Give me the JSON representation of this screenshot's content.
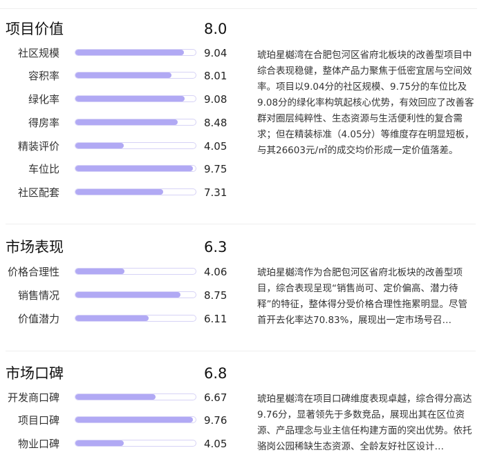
{
  "sections": [
    {
      "title": "项目价值",
      "score": "8.0",
      "metrics": [
        {
          "label": "社区规模",
          "value": "9.04",
          "fraction": 0.904
        },
        {
          "label": "容积率",
          "value": "8.01",
          "fraction": 0.801
        },
        {
          "label": "绿化率",
          "value": "9.08",
          "fraction": 0.908
        },
        {
          "label": "得房率",
          "value": "8.48",
          "fraction": 0.848
        },
        {
          "label": "精装评价",
          "value": "4.05",
          "fraction": 0.405
        },
        {
          "label": "车位比",
          "value": "9.75",
          "fraction": 0.975
        },
        {
          "label": "社区配套",
          "value": "7.31",
          "fraction": 0.731
        }
      ],
      "description": "琥珀星樾湾在合肥包河区省府北板块的改善型项目中综合表现稳健，整体产品力聚焦于低密宜居与空间效率。项目以9.04分的社区规模、9.75分的车位比及9.08分的绿化率构筑起核心优势，有效回应了改善客群对圈层纯粹性、生态资源与生活便利性的复合需求；但在精装标准（4.05分）等维度存在明显短板，与其26603元/㎡的成交均价形成一定价值落差。"
    },
    {
      "title": "市场表现",
      "score": "6.3",
      "metrics": [
        {
          "label": "价格合理性",
          "value": "4.06",
          "fraction": 0.406
        },
        {
          "label": "销售情况",
          "value": "8.75",
          "fraction": 0.875
        },
        {
          "label": "价值潜力",
          "value": "6.11",
          "fraction": 0.611
        }
      ],
      "description": "琥珀星樾湾作为合肥包河区省府北板块的改善型项目，综合表现呈现“销售尚可、定价偏高、潜力待释”的特征，整体得分受价格合理性拖累明显。尽管首开去化率达70.83%，展现出一定市场号召…"
    },
    {
      "title": "市场口碑",
      "score": "6.8",
      "metrics": [
        {
          "label": "开发商口碑",
          "value": "6.67",
          "fraction": 0.667
        },
        {
          "label": "项目口碑",
          "value": "9.76",
          "fraction": 0.976
        },
        {
          "label": "物业口碑",
          "value": "4.05",
          "fraction": 0.405
        }
      ],
      "description": "琥珀星樾湾在项目口碑维度表现卓越，综合得分高达9.76分，显著领先于多数竞品，展现出其在区位资源、产品理念与业主信任构建方面的突出优势。依托骆岗公园稀缺生态资源、全龄友好社区设计…"
    }
  ]
}
